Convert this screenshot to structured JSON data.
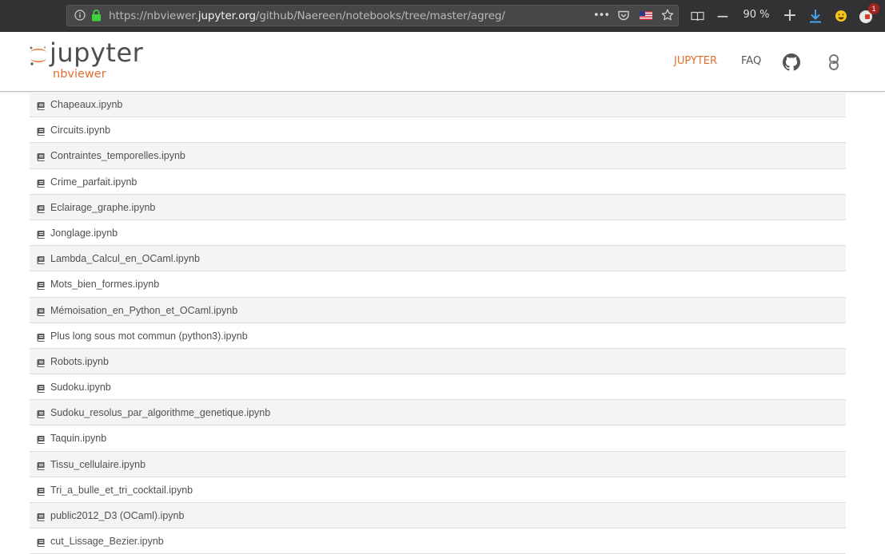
{
  "browser": {
    "url_prefix": "https://nbviewer.",
    "url_host": "jupyter.org",
    "url_path": "/github/Naereen/notebooks/tree/master/agreg/",
    "menu_dots": "•••",
    "zoom_level": "90 %",
    "zoom_out_label": "−",
    "zoom_in_label": "+",
    "notification_count": "1",
    "icons": [
      "info-icon",
      "lock-icon",
      "page-actions-icon",
      "pocket-icon",
      "flag-icon",
      "bookmark-star-icon",
      "reader-view-icon",
      "zoom-out-icon",
      "zoom-in-icon",
      "download-icon",
      "emoji-icon",
      "extension-icon"
    ]
  },
  "header": {
    "logo_text": "jupyter",
    "logo_sub": "nbviewer",
    "nav": {
      "jupyter": "JUPYTER",
      "faq": "FAQ"
    },
    "colors": {
      "accent": "#e46e2e",
      "text": "#555555"
    },
    "icons": [
      "github-icon",
      "binder-icon"
    ]
  },
  "files": [
    "Chapeaux.ipynb",
    "Circuits.ipynb",
    "Contraintes_temporelles.ipynb",
    "Crime_parfait.ipynb",
    "Eclairage_graphe.ipynb",
    "Jonglage.ipynb",
    "Lambda_Calcul_en_OCaml.ipynb",
    "Mots_bien_formes.ipynb",
    "Mémoisation_en_Python_et_OCaml.ipynb",
    "Plus long sous mot commun (python3).ipynb",
    "Robots.ipynb",
    "Sudoku.ipynb",
    "Sudoku_resolus_par_algorithme_genetique.ipynb",
    "Taquin.ipynb",
    "Tissu_cellulaire.ipynb",
    "Tri_a_bulle_et_tri_cocktail.ipynb",
    "public2012_D3 (OCaml).ipynb",
    "cut_Lissage_Bezier.ipynb"
  ],
  "file_icon": "notebook-icon"
}
